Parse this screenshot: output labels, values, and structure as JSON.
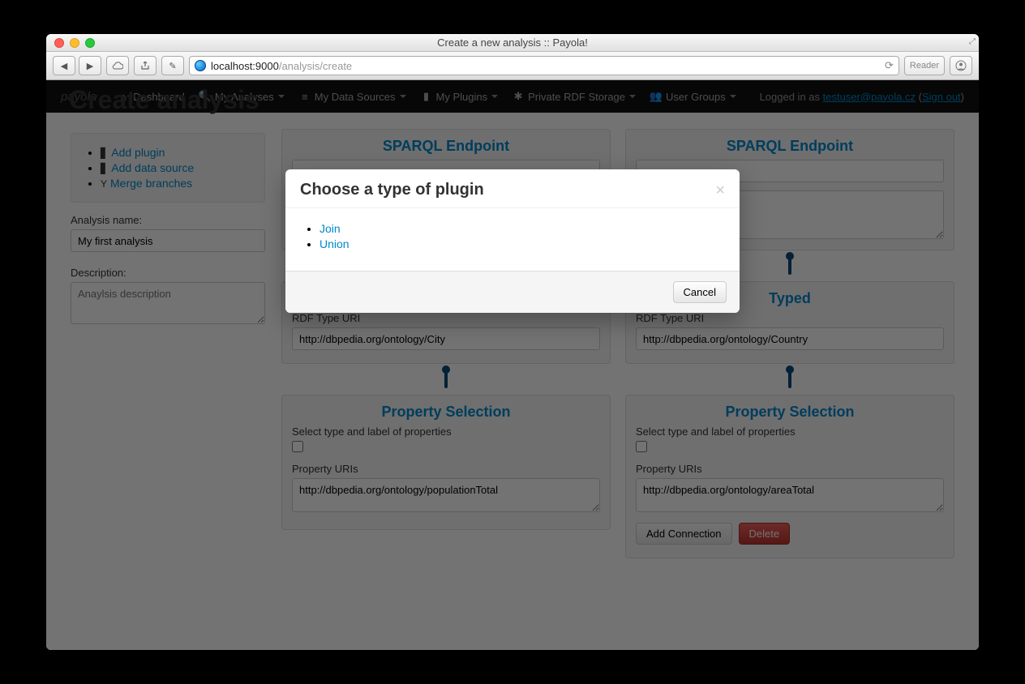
{
  "window": {
    "title": "Create a new analysis :: Payola!"
  },
  "browser": {
    "url_prefix": "localhost:9000",
    "url_path": "/analysis/create",
    "reader_label": "Reader"
  },
  "nav": {
    "brand": "payola",
    "items": [
      {
        "label": "Dashboard",
        "dropdown": false
      },
      {
        "label": "My Analyses",
        "dropdown": true
      },
      {
        "label": "My Data Sources",
        "dropdown": true
      },
      {
        "label": "My Plugins",
        "dropdown": true
      },
      {
        "label": "Private RDF Storage",
        "dropdown": true
      },
      {
        "label": "User Groups",
        "dropdown": true
      }
    ],
    "logged_in_as": "Logged in as ",
    "user": "testuser@payola.cz",
    "sign_out": "Sign out"
  },
  "page_title": "Create analysis",
  "sidebar": {
    "actions": [
      {
        "label": "Add plugin",
        "icon": "plus-block"
      },
      {
        "label": "Add data source",
        "icon": "plus-block"
      },
      {
        "label": "Merge branches",
        "icon": "merge"
      }
    ],
    "name_label": "Analysis name:",
    "name_value": "My first analysis",
    "desc_label": "Description:",
    "desc_placeholder": "Anaylsis description"
  },
  "nodes": {
    "sparql_title": "SPARQL Endpoint",
    "typed_title": "Typed",
    "typed_label": "RDF Type URI",
    "propsel_title": "Property Selection",
    "propsel_checkbox_label": "Select type and label of properties",
    "propsel_field_label": "Property URIs",
    "left": {
      "typed_value": "http://dbpedia.org/ontology/City",
      "prop_value": "http://dbpedia.org/ontology/populationTotal"
    },
    "right": {
      "typed_value": "http://dbpedia.org/ontology/Country",
      "prop_value": "http://dbpedia.org/ontology/areaTotal"
    },
    "add_connection": "Add Connection",
    "delete": "Delete"
  },
  "modal": {
    "title": "Choose a type of plugin",
    "options": [
      "Join",
      "Union"
    ],
    "cancel": "Cancel"
  }
}
